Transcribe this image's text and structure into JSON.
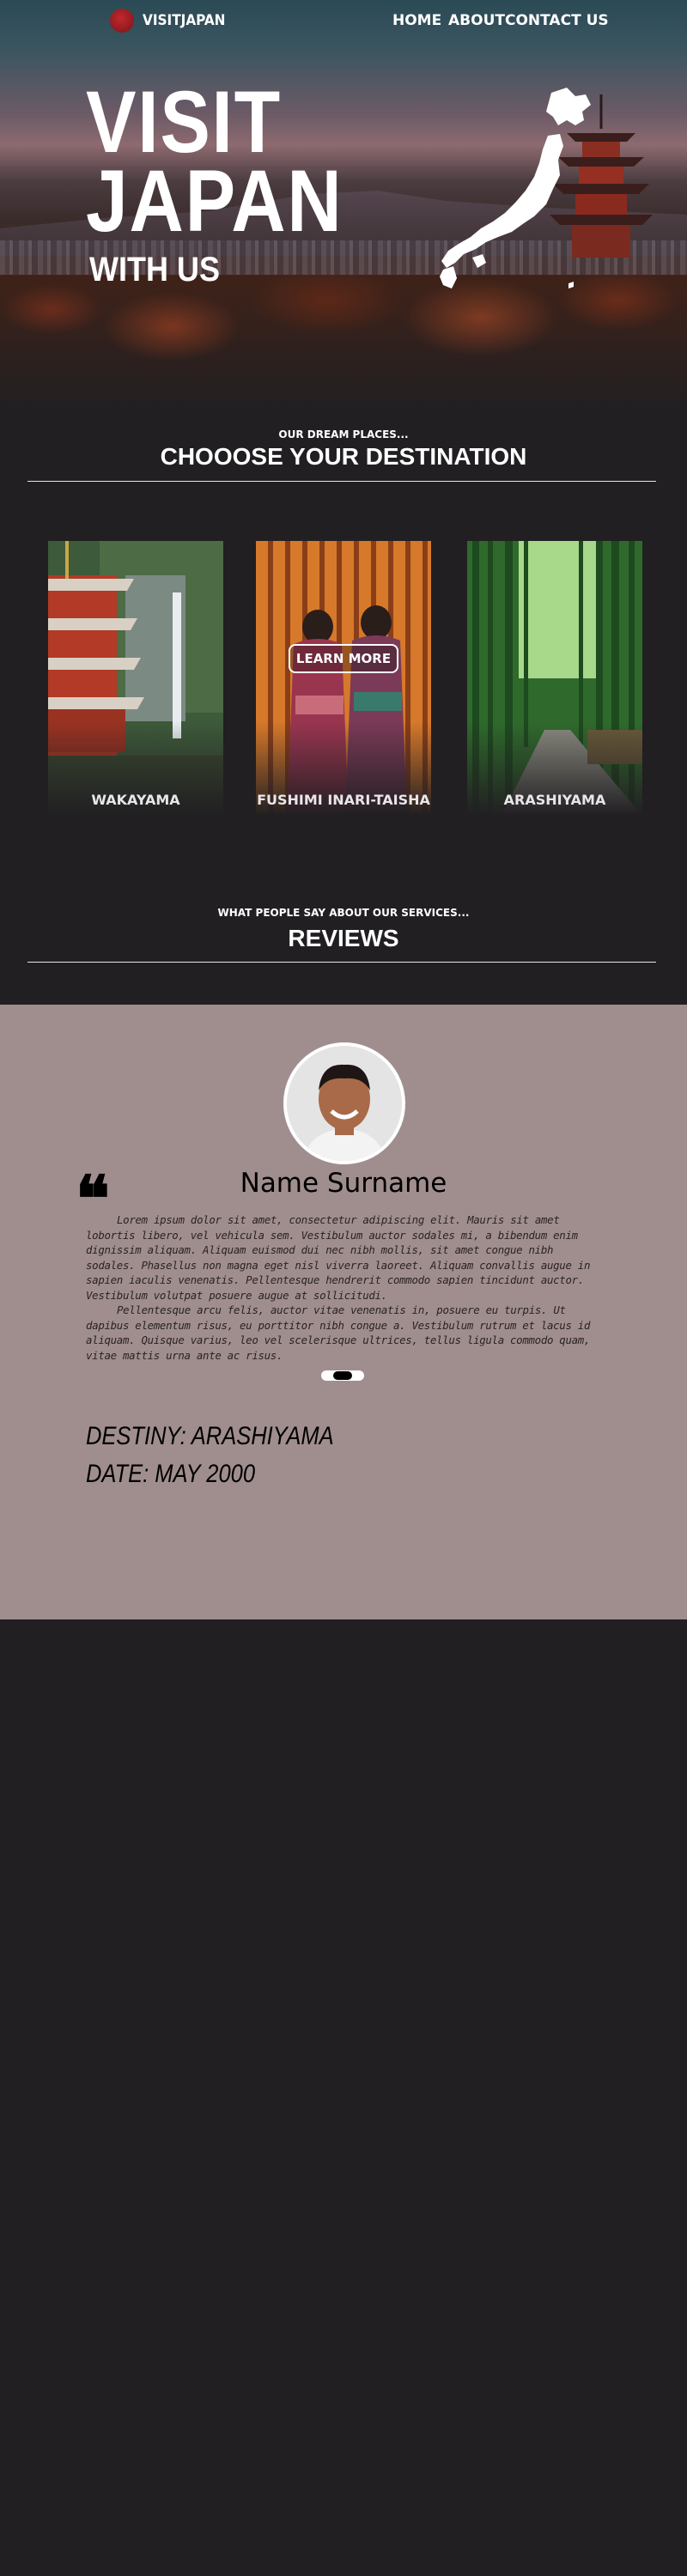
{
  "nav": {
    "brand": "VISITJAPAN",
    "links": [
      "HOME",
      "ABOUT",
      "CONTACT US"
    ]
  },
  "hero": {
    "title_line1": "VISIT",
    "title_line2": "JAPAN",
    "subtitle": "WITH US"
  },
  "destinations": {
    "kicker": "OUR DREAM PLACES...",
    "title": "CHOOOSE YOUR DESTINATION",
    "cards": [
      {
        "label": "WAKAYAMA"
      },
      {
        "label": "FUSHIMI INARI-TAISHA",
        "button": "LEARN MORE"
      },
      {
        "label": "ARASHIYAMA"
      }
    ]
  },
  "reviews": {
    "kicker": "WHAT PEOPLE SAY ABOUT OUR SERVICES...",
    "title": "REVIEWS",
    "reviewer": "Name Surname",
    "paragraphs": [
      "Lorem ipsum dolor sit amet, consectetur adipiscing elit. Mauris sit amet lobortis libero, vel vehicula sem. Vestibulum auctor sodales mi, a bibendum enim dignissim aliquam. Aliquam euismod dui nec nibh mollis, sit amet congue nibh sodales. Phasellus non magna eget nisl viverra laoreet. Aliquam convallis augue in sapien iaculis venenatis. Pellentesque hendrerit commodo sapien tincidunt auctor. Vestibulum volutpat posuere augue at sollicitudi.",
      "Pellentesque arcu felis, auctor vitae venenatis in, posuere eu turpis. Ut dapibus elementum risus, eu porttitor nibh congue a. Vestibulum rutrum et lacus id aliquam. Quisque varius, leo vel scelerisque ultrices, tellus ligula commodo quam, vitae mattis urna ante ac risus."
    ],
    "destiny": "DESTINY: ARASHIYAMA",
    "date": "DATE: MAY 2000"
  },
  "colors": {
    "page_bg": "#211f22",
    "reviews_bg": "#a08e8e",
    "brand_red": "#c0282e"
  }
}
